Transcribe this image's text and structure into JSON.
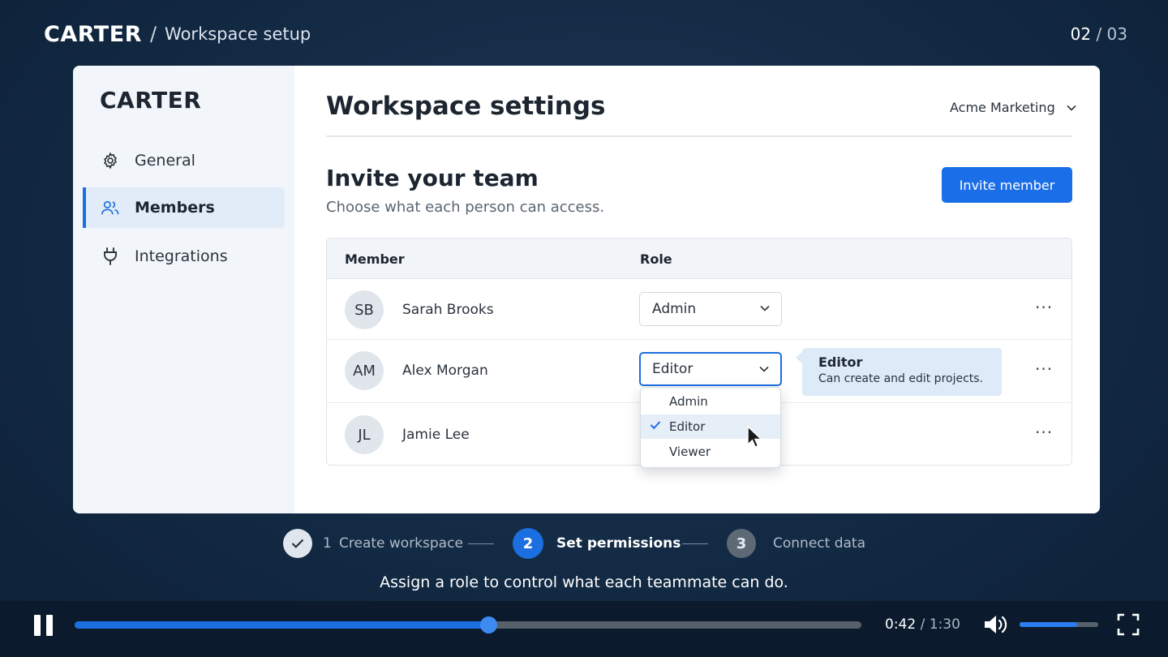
{
  "header": {
    "brand": "CARTER",
    "separator": "/",
    "crumb": "Workspace setup",
    "step_current": "02",
    "step_sep": "/",
    "step_total": "03"
  },
  "sidebar": {
    "logo": "CARTER",
    "items": [
      {
        "label": "General",
        "icon": "gear-icon"
      },
      {
        "label": "Members",
        "icon": "users-icon",
        "active": true
      },
      {
        "label": "Integrations",
        "icon": "plug-icon"
      }
    ]
  },
  "main": {
    "title": "Workspace settings",
    "workspace": "Acme Marketing",
    "section_title": "Invite your team",
    "section_sub": "Choose what each person can access.",
    "invite_label": "Invite member",
    "columns": [
      "Member",
      "Role"
    ],
    "members": [
      {
        "initials": "SB",
        "name": "Sarah Brooks",
        "role": "Admin"
      },
      {
        "initials": "AM",
        "name": "Alex Morgan",
        "role": "Editor"
      },
      {
        "initials": "JL",
        "name": "Jamie Lee",
        "role": ""
      }
    ],
    "more_label": "···",
    "role_options": [
      "Admin",
      "Editor",
      "Viewer"
    ],
    "selected_option": "Editor",
    "tooltip": {
      "title": "Editor",
      "text": "Can create and edit projects."
    }
  },
  "steps": [
    {
      "num": "1",
      "label": "Create workspace",
      "state": "done"
    },
    {
      "num": "2",
      "label": "Set permissions",
      "state": "current"
    },
    {
      "num": "3",
      "label": "Connect data",
      "state": "upcoming"
    }
  ],
  "caption": "Assign a role to control what each teammate can do.",
  "player": {
    "time_current": "0:42",
    "time_sep": "/",
    "time_total": "1:30",
    "progress": 0.526,
    "volume": 0.73
  },
  "colors": {
    "accent": "#1a6ee8",
    "background": "#132a44"
  }
}
